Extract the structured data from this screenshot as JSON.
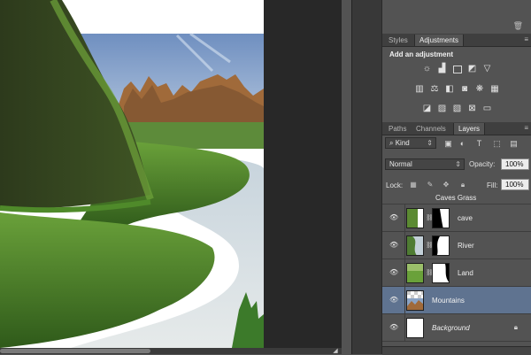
{
  "panels": {
    "adjustments": {
      "tabs": [
        "Styles",
        "Adjustments"
      ],
      "active_tab": "Adjustments",
      "title": "Add an adjustment",
      "row1": [
        "brightness-contrast-icon",
        "levels-icon",
        "curves-icon",
        "exposure-icon",
        "vibrance-icon"
      ],
      "row2": [
        "hue-saturation-icon",
        "color-balance-icon",
        "black-white-icon",
        "photo-filter-icon",
        "channel-mixer-icon",
        "color-lookup-icon"
      ],
      "row3": [
        "invert-icon",
        "posterize-icon",
        "threshold-icon",
        "selective-color-icon",
        "gradient-map-icon"
      ]
    },
    "layers": {
      "tabs": [
        "Paths",
        "Channels",
        "Layers"
      ],
      "active_tab": "Layers",
      "filter_kind": "Kind",
      "blend_mode": "Normal",
      "opacity_label": "Opacity:",
      "opacity_value": "100%",
      "lock_label": "Lock:",
      "fill_label": "Fill:",
      "fill_value": "100%",
      "group_name": "Caves Grass",
      "items": [
        {
          "name": "cave",
          "thumb": "cave-thumb",
          "mask": true,
          "selected": false
        },
        {
          "name": "River",
          "thumb": "river-thumb",
          "mask": true,
          "selected": false
        },
        {
          "name": "Land",
          "thumb": "land-thumb",
          "mask": true,
          "selected": false
        },
        {
          "name": "Mountains",
          "thumb": "mountains-thumb",
          "mask": false,
          "selected": true
        },
        {
          "name": "Background",
          "thumb": "background-thumb",
          "mask": false,
          "selected": false,
          "locked": true
        }
      ]
    }
  },
  "colors": {
    "panel_bg": "#535353",
    "selected_layer": "#5f7390",
    "canvas_bg": "#282828"
  }
}
